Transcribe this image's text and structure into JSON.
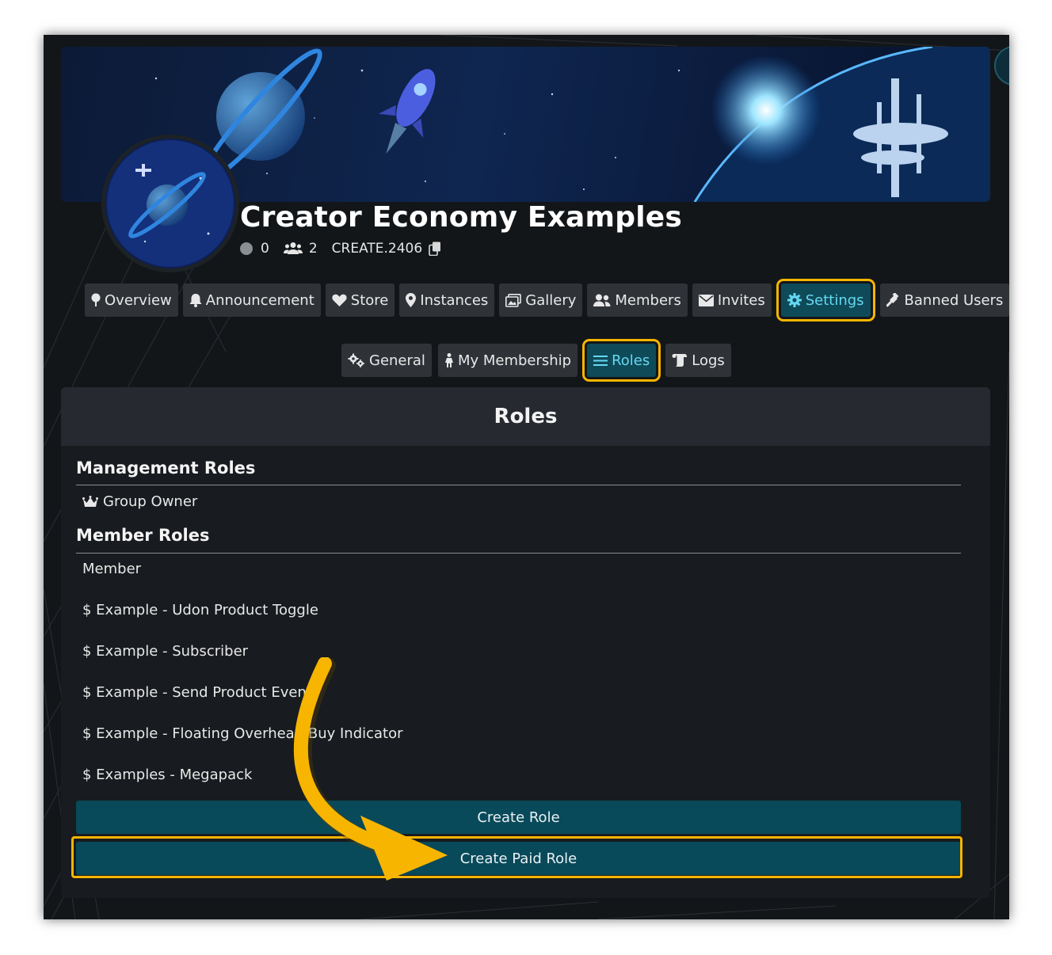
{
  "group": {
    "name": "Creator Economy Examples",
    "online_count": "0",
    "member_count": "2",
    "short_code": "CREATE.2406"
  },
  "main_tabs": [
    {
      "label": "Overview",
      "icon": "map-pin-icon",
      "active": false
    },
    {
      "label": "Announcement",
      "icon": "bell-icon",
      "active": false
    },
    {
      "label": "Store",
      "icon": "heart-icon",
      "active": false
    },
    {
      "label": "Instances",
      "icon": "location-icon",
      "active": false
    },
    {
      "label": "Gallery",
      "icon": "images-icon",
      "active": false
    },
    {
      "label": "Members",
      "icon": "users-icon",
      "active": false
    },
    {
      "label": "Invites",
      "icon": "envelope-icon",
      "active": false
    },
    {
      "label": "Settings",
      "icon": "gear-icon",
      "active": true
    },
    {
      "label": "Banned Users",
      "icon": "gavel-icon",
      "active": false
    }
  ],
  "sub_tabs": [
    {
      "label": "General",
      "icon": "gears-icon",
      "active": false
    },
    {
      "label": "My Membership",
      "icon": "person-icon",
      "active": false
    },
    {
      "label": "Roles",
      "icon": "list-icon",
      "active": true
    },
    {
      "label": "Logs",
      "icon": "scroll-icon",
      "active": false
    }
  ],
  "panel": {
    "title": "Roles",
    "management_title": "Management Roles",
    "management_roles": [
      {
        "label": "Group Owner",
        "icon": "crown-icon"
      }
    ],
    "member_title": "Member Roles",
    "member_roles": [
      "Member",
      "$ Example - Udon Product Toggle",
      "$ Example - Subscriber",
      "$ Example - Send Product Event",
      "$ Example - Floating Overhead Buy Indicator",
      "$ Examples - Megapack"
    ],
    "create_role_label": "Create Role",
    "create_paid_role_label": "Create Paid Role"
  },
  "colors": {
    "highlight": "#f7b500",
    "active_tab_bg": "#0f4a58",
    "active_tab_text": "#64d8f2",
    "button_bg": "#08495a"
  }
}
